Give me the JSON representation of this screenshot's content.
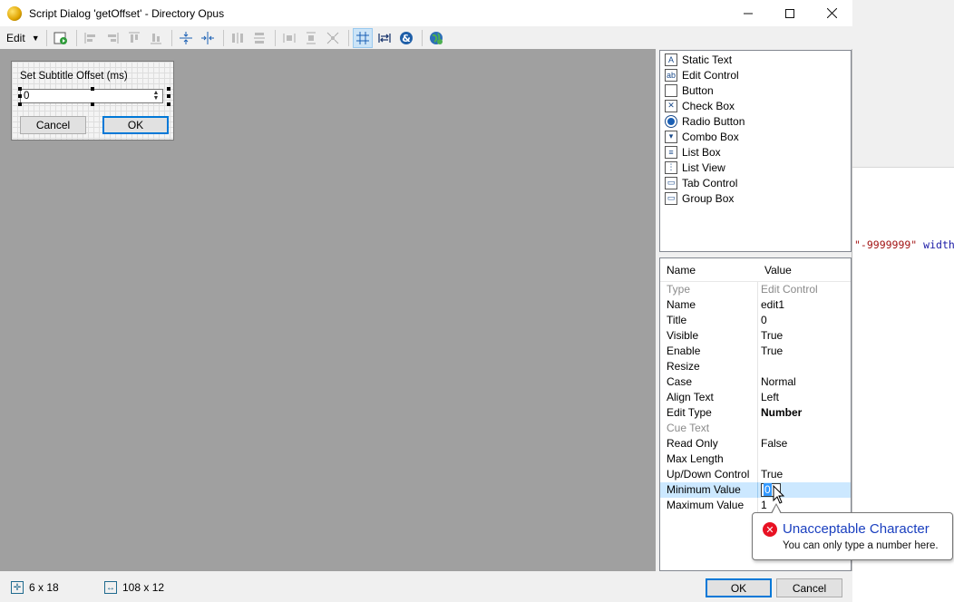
{
  "window": {
    "title": "Script Dialog 'getOffset' - Directory Opus"
  },
  "toolbar": {
    "edit_label": "Edit"
  },
  "preview": {
    "title": "Set Subtitle Offset (ms)",
    "edit_value": "0",
    "cancel_label": "Cancel",
    "ok_label": "OK"
  },
  "controls": [
    {
      "label": "Static Text",
      "icon": "static-text-icon"
    },
    {
      "label": "Edit Control",
      "icon": "edit-control-icon"
    },
    {
      "label": "Button",
      "icon": "button-icon"
    },
    {
      "label": "Check Box",
      "icon": "check-box-icon"
    },
    {
      "label": "Radio Button",
      "icon": "radio-button-icon"
    },
    {
      "label": "Combo Box",
      "icon": "combo-box-icon"
    },
    {
      "label": "List Box",
      "icon": "list-box-icon"
    },
    {
      "label": "List View",
      "icon": "list-view-icon"
    },
    {
      "label": "Tab Control",
      "icon": "tab-control-icon"
    },
    {
      "label": "Group Box",
      "icon": "group-box-icon"
    }
  ],
  "properties": {
    "header_name": "Name",
    "header_value": "Value",
    "rows": [
      {
        "name": "Type",
        "value": "Edit Control"
      },
      {
        "name": "Name",
        "value": "edit1"
      },
      {
        "name": "Title",
        "value": "0"
      },
      {
        "name": "Visible",
        "value": "True"
      },
      {
        "name": "Enable",
        "value": "True"
      },
      {
        "name": "Resize",
        "value": ""
      },
      {
        "name": "Case",
        "value": "Normal"
      },
      {
        "name": "Align Text",
        "value": "Left"
      },
      {
        "name": "Edit Type",
        "value": "Number"
      },
      {
        "name": "Cue Text",
        "value": ""
      },
      {
        "name": "Read Only",
        "value": "False"
      },
      {
        "name": "Max Length",
        "value": ""
      },
      {
        "name": "Up/Down Control",
        "value": "True"
      },
      {
        "name": "Minimum Value",
        "value": "0"
      },
      {
        "name": "Maximum Value",
        "value": "1"
      }
    ]
  },
  "tooltip": {
    "title": "Unacceptable Character",
    "message": "You can only type a number here."
  },
  "status": {
    "position": "6 x 18",
    "size": "108 x 12"
  },
  "buttons": {
    "ok": "OK",
    "cancel": "Cancel"
  },
  "background_code": {
    "string_part": "\"-9999999\"",
    "attr_part": " width="
  }
}
